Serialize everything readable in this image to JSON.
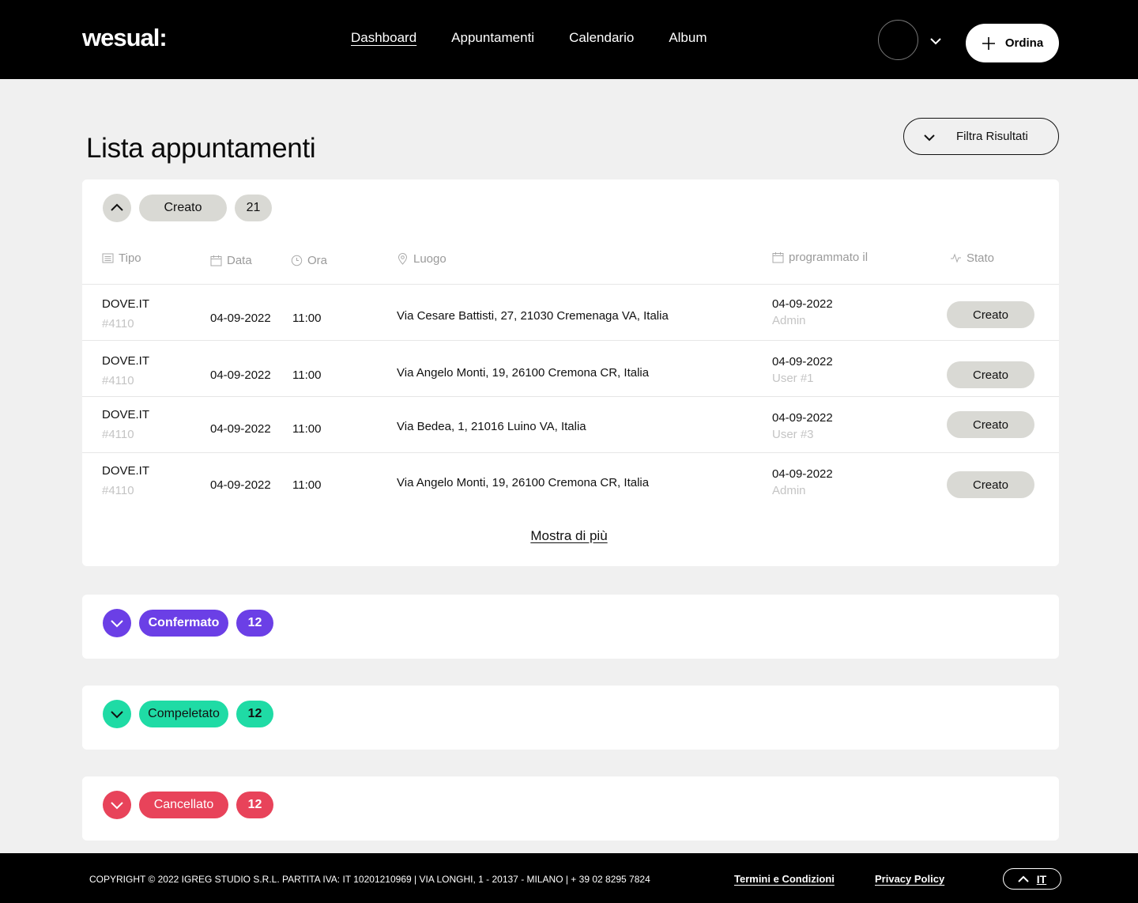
{
  "header": {
    "logo": "wesual:",
    "nav": [
      {
        "label": "Dashboard"
      },
      {
        "label": "Appuntamenti"
      },
      {
        "label": "Calendario"
      },
      {
        "label": "Album"
      }
    ],
    "order_label": "Ordina"
  },
  "page": {
    "title": "Lista appuntamenti",
    "filter_label": "Filtra Risultati"
  },
  "groups": {
    "created": {
      "label": "Creato",
      "count": "21",
      "color": "#d9d9d4"
    },
    "confirmed": {
      "label": "Confermato",
      "count": "12",
      "color": "#6b3fe6"
    },
    "completed": {
      "label": "Compeletato",
      "count": "12",
      "color": "#1fdba5"
    },
    "cancelled": {
      "label": "Cancellato",
      "count": "12",
      "color": "#e8435a"
    }
  },
  "table": {
    "columns": {
      "type": "Tipo",
      "date": "Data",
      "time": "Ora",
      "place": "Luogo",
      "scheduled": "programmato il",
      "status": "Stato"
    },
    "rows": [
      {
        "type": "DOVE.IT",
        "id": "#4110",
        "date": "04-09-2022",
        "time": "11:00",
        "place": "Via Cesare Battisti, 27, 21030 Cremenaga VA, Italia",
        "scheduled": "04-09-2022",
        "by": "Admin",
        "status": "Creato"
      },
      {
        "type": "DOVE.IT",
        "id": "#4110",
        "date": "04-09-2022",
        "time": "11:00",
        "place": "Via Angelo Monti, 19, 26100 Cremona CR, Italia",
        "scheduled": "04-09-2022",
        "by": "User #1",
        "status": "Creato"
      },
      {
        "type": "DOVE.IT",
        "id": "#4110",
        "date": "04-09-2022",
        "time": "11:00",
        "place": "Via Bedea, 1, 21016 Luino VA, Italia",
        "scheduled": "04-09-2022",
        "by": "User #3",
        "status": "Creato"
      },
      {
        "type": "DOVE.IT",
        "id": "#4110",
        "date": "04-09-2022",
        "time": "11:00",
        "place": "Via Angelo Monti, 19, 26100 Cremona CR, Italia",
        "scheduled": "04-09-2022",
        "by": "Admin",
        "status": "Creato"
      }
    ],
    "more_label": "Mostra di più"
  },
  "footer": {
    "copyright": "COPYRIGHT © 2022 IGREG STUDIO S.R.L. PARTITA IVA: IT 10201210969 | VIA LONGHI, 1 - 20137 - MILANO | + 39 02 8295 7824",
    "terms": "Termini e Condizioni",
    "privacy": "Privacy Policy",
    "language": "IT"
  }
}
